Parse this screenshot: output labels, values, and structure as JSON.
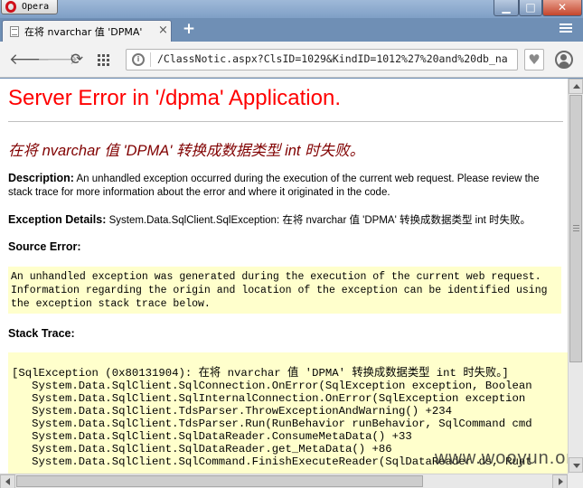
{
  "browser": {
    "menu_label": "Opera",
    "tab": {
      "title": "在将 nvarchar 值 'DPMA'",
      "close": "×"
    },
    "new_tab": "+",
    "address": "/ClassNotic.aspx?ClsID=1029&KindID=1012%27%20and%20db_na",
    "window_controls": {
      "minimize": "▁",
      "maximize": "□",
      "close": "✕"
    },
    "icons": [
      "opera-logo",
      "page-icon",
      "close-icon",
      "plus-icon",
      "menu-icon",
      "back-icon",
      "forward-icon",
      "reload-icon",
      "speed-dial-icon",
      "site-info-icon",
      "heart-icon",
      "profile-icon"
    ]
  },
  "page": {
    "title": "Server Error in '/dpma' Application.",
    "error_message": "在将 nvarchar 值 'DPMA' 转换成数据类型 int 时失败。",
    "description_label": "Description:",
    "description_text": "An unhandled exception occurred during the execution of the current web request. Please review the stack trace for more information about the error and where it originated in the code.",
    "exception_label": "Exception Details:",
    "exception_text": "System.Data.SqlClient.SqlException: 在将 nvarchar 值 'DPMA' 转换成数据类型 int 时失败。",
    "source_label": "Source Error:",
    "source_text": "An unhandled exception was generated during the execution of the current web request.\nInformation regarding the origin and location of the exception can be identified using\nthe exception stack trace below.",
    "stack_label": "Stack Trace:",
    "stack_text": "[SqlException (0x80131904): 在将 nvarchar 值 'DPMA' 转换成数据类型 int 时失败。]\n   System.Data.SqlClient.SqlConnection.OnError(SqlException exception, Boolean\n   System.Data.SqlClient.SqlInternalConnection.OnError(SqlException exception\n   System.Data.SqlClient.TdsParser.ThrowExceptionAndWarning() +234\n   System.Data.SqlClient.TdsParser.Run(RunBehavior runBehavior, SqlCommand cmd\n   System.Data.SqlClient.SqlDataReader.ConsumeMetaData() +33\n   System.Data.SqlClient.SqlDataReader.get_MetaData() +86\n   System.Data.SqlClient.SqlCommand.FinishExecuteReader(SqlDataReader ds, Runt",
    "watermark": "www.wooyun.org"
  },
  "colors": {
    "title_red": "#ff0000",
    "message_maroon": "#800000",
    "code_bg": "#ffffcc"
  }
}
